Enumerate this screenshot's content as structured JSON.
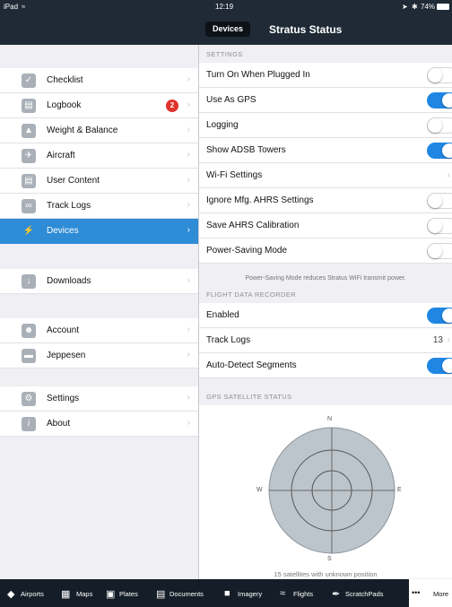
{
  "status_bar": {
    "device": "iPad",
    "time": "12:19",
    "battery": "74%"
  },
  "nav": {
    "segment": "Devices",
    "title": "Stratus Status"
  },
  "sidebar": {
    "items": [
      {
        "label": "Checklist",
        "icon": "checkmark-icon"
      },
      {
        "label": "Logbook",
        "icon": "book-icon",
        "badge": "2"
      },
      {
        "label": "Weight & Balance",
        "icon": "scale-icon"
      },
      {
        "label": "Aircraft",
        "icon": "airplane-icon"
      },
      {
        "label": "User Content",
        "icon": "document-icon"
      },
      {
        "label": "Track Logs",
        "icon": "track-icon"
      },
      {
        "label": "Devices",
        "icon": "plug-icon",
        "selected": true
      },
      {
        "label": "Downloads",
        "icon": "download-icon"
      },
      {
        "label": "Account",
        "icon": "person-icon"
      },
      {
        "label": "Jeppesen",
        "icon": "jeppesen-icon"
      },
      {
        "label": "Settings",
        "icon": "gear-icon"
      },
      {
        "label": "About",
        "icon": "info-icon"
      }
    ]
  },
  "settings": {
    "header": "SETTINGS",
    "rows": [
      {
        "label": "Turn On When Plugged In",
        "toggle": false
      },
      {
        "label": "Use As GPS",
        "toggle": true
      },
      {
        "label": "Logging",
        "toggle": false
      },
      {
        "label": "Show ADSB Towers",
        "toggle": true
      },
      {
        "label": "Wi-Fi Settings",
        "chevron": true
      },
      {
        "label": "Ignore Mfg. AHRS Settings",
        "toggle": false
      },
      {
        "label": "Save AHRS Calibration",
        "toggle": false
      },
      {
        "label": "Power-Saving Mode",
        "toggle": false
      }
    ],
    "note": "Power-Saving Mode reduces Stratus WiFi transmit power."
  },
  "flight_recorder": {
    "header": "FLIGHT DATA RECORDER",
    "rows": [
      {
        "label": "Enabled",
        "toggle": true
      },
      {
        "label": "Track Logs",
        "value": "13"
      },
      {
        "label": "Auto-Detect Segments",
        "toggle": true
      }
    ]
  },
  "gps": {
    "header": "GPS SATELLITE STATUS",
    "north": "N",
    "south": "S",
    "east": "E",
    "west": "W",
    "footer": "15 satellites with unknown position"
  },
  "tabbar": {
    "tabs": [
      {
        "label": "Airports",
        "icon": "airport-icon"
      },
      {
        "label": "Maps",
        "icon": "map-icon"
      },
      {
        "label": "Plates",
        "icon": "plates-icon"
      },
      {
        "label": "Documents",
        "icon": "documents-icon"
      },
      {
        "label": "Imagery",
        "icon": "imagery-icon"
      },
      {
        "label": "Flights",
        "icon": "flights-icon"
      },
      {
        "label": "ScratchPads",
        "icon": "pen-icon"
      },
      {
        "label": "More",
        "icon": "more-icon",
        "selected": true
      }
    ]
  },
  "colors": {
    "accent": "#1f86e3",
    "nav_bg": "#1f2a36",
    "tab_bg": "#151e28",
    "badge": "#e0322d"
  }
}
